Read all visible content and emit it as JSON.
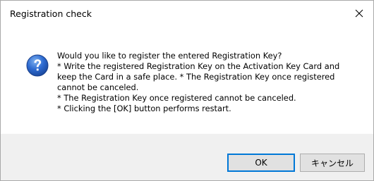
{
  "window": {
    "title": "Registration check",
    "close_glyph": "close-icon"
  },
  "message": {
    "icon": "question-icon",
    "lines": [
      "Would you like to register the entered Registration Key?",
      "* Write the registered Registration Key on the Activation Key Card and",
      "keep the Card in a safe place. * The Registration Key once registered",
      "cannot be canceled.",
      "* The Registration Key once registered cannot be canceled.",
      "* Clicking the [OK] button performs restart."
    ]
  },
  "buttons": {
    "ok_label": "OK",
    "cancel_label": "キャンセル"
  },
  "colors": {
    "icon_blue": "#2e6bd1",
    "focus_border": "#0078d7",
    "footer_bg": "#f0f0f0"
  }
}
